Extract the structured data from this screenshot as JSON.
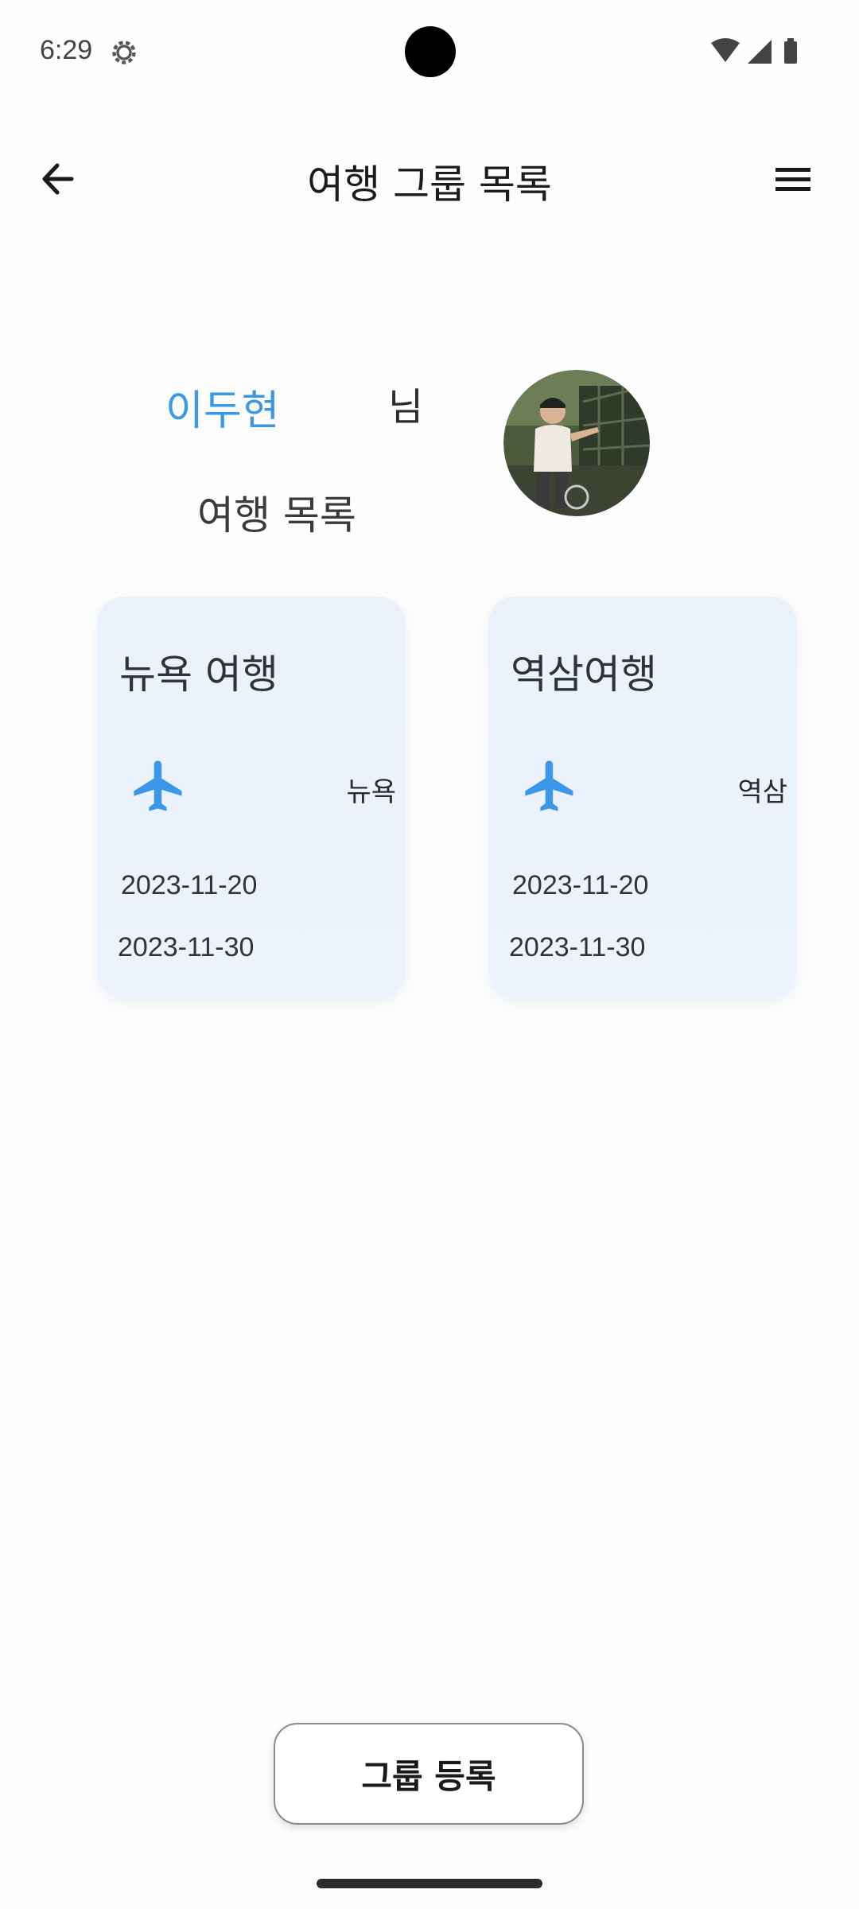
{
  "status_bar": {
    "time": "6:29",
    "icons": [
      "settings-icon",
      "wifi-icon",
      "signal-icon",
      "battery-icon"
    ]
  },
  "app_bar": {
    "title": "여행 그룹 목록",
    "back_icon": "arrow-left-icon",
    "menu_icon": "menu-icon"
  },
  "user": {
    "name": "이두현",
    "suffix": "님",
    "list_title": "여행 목록",
    "name_color": "#3b98e8"
  },
  "trips": [
    {
      "title": "뉴욕 여행",
      "destination": "뉴욕",
      "start_date": "2023-11-20",
      "end_date": "2023-11-30",
      "icon": "airplane-icon"
    },
    {
      "title": "역삼여행",
      "destination": "역삼",
      "start_date": "2023-11-20",
      "end_date": "2023-11-30",
      "icon": "airplane-icon"
    }
  ],
  "actions": {
    "register_label": "그룹 등록"
  },
  "colors": {
    "accent": "#3b98e8",
    "card_background": "#eaf1fb",
    "page_background": "#fdfdfe"
  }
}
